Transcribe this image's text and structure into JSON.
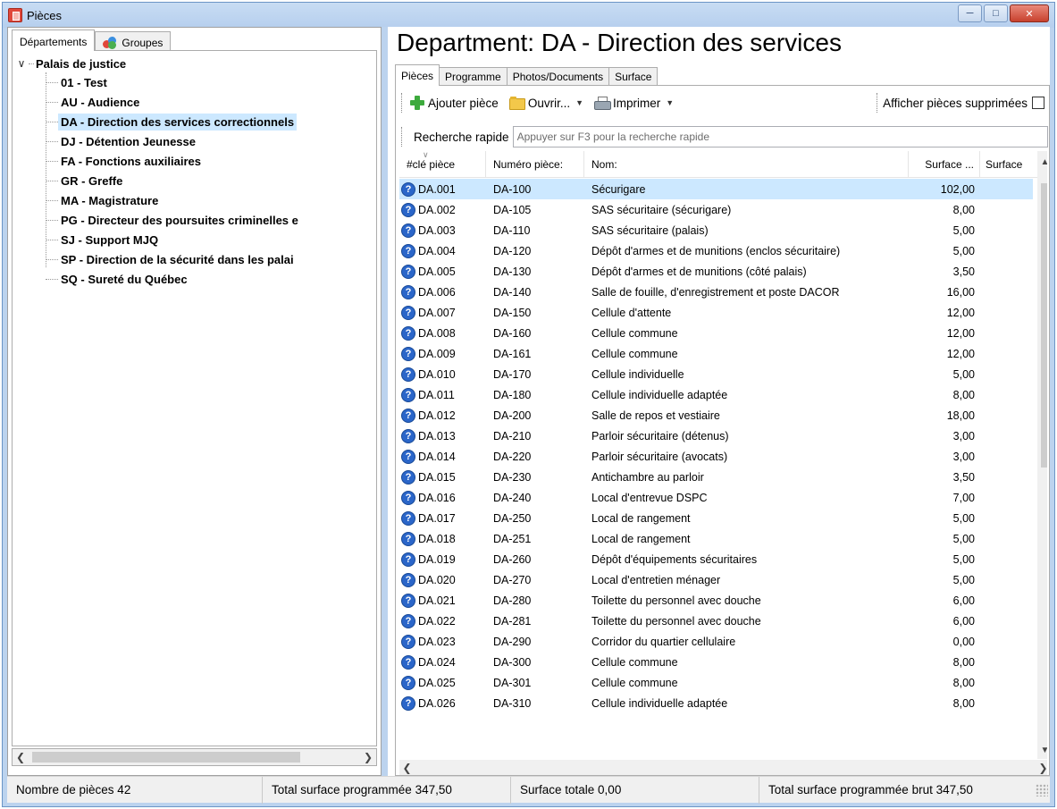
{
  "window": {
    "title": "Pièces"
  },
  "left": {
    "tabs": [
      "Départements",
      "Groupes"
    ],
    "tree": {
      "root": "Palais de justice",
      "items": [
        "01 - Test",
        "AU - Audience",
        "DA - Direction des services correctionnels",
        "DJ - Détention Jeunesse",
        "FA - Fonctions auxiliaires",
        "GR - Greffe",
        "MA - Magistrature",
        "PG - Directeur des poursuites criminelles e",
        "SJ - Support MJQ",
        "SP - Direction de la sécurité dans les palai",
        "SQ - Sureté du Québec"
      ],
      "selected_index": 2
    }
  },
  "main": {
    "title": "Department: DA - Direction des services",
    "tabs": [
      "Pièces",
      "Programme",
      "Photos/Documents",
      "Surface"
    ],
    "toolbar": {
      "add": "Ajouter pièce",
      "open": "Ouvrir...",
      "print": "Imprimer",
      "show_deleted": "Afficher pièces supprimées"
    },
    "search": {
      "label": "Recherche rapide",
      "placeholder": "Appuyer sur F3 pour la recherche rapide",
      "value": ""
    },
    "grid": {
      "columns": [
        "#clé pièce",
        "Numéro pièce:",
        "Nom:",
        "Surface ...",
        "Surface"
      ],
      "rows": [
        {
          "key": "DA.001",
          "num": "DA-100",
          "name": "Sécurigare",
          "surface": "102,00"
        },
        {
          "key": "DA.002",
          "num": "DA-105",
          "name": "SAS sécuritaire (sécurigare)",
          "surface": "8,00"
        },
        {
          "key": "DA.003",
          "num": "DA-110",
          "name": "SAS sécuritaire (palais)",
          "surface": "5,00"
        },
        {
          "key": "DA.004",
          "num": "DA-120",
          "name": "Dépôt d'armes et de munitions (enclos sécuritaire)",
          "surface": "5,00"
        },
        {
          "key": "DA.005",
          "num": "DA-130",
          "name": "Dépôt d'armes et de munitions (côté palais)",
          "surface": "3,50"
        },
        {
          "key": "DA.006",
          "num": "DA-140",
          "name": "Salle de fouille, d'enregistrement et poste DACOR",
          "surface": "16,00"
        },
        {
          "key": "DA.007",
          "num": "DA-150",
          "name": "Cellule d'attente",
          "surface": "12,00"
        },
        {
          "key": "DA.008",
          "num": "DA-160",
          "name": "Cellule commune",
          "surface": "12,00"
        },
        {
          "key": "DA.009",
          "num": "DA-161",
          "name": "Cellule commune",
          "surface": "12,00"
        },
        {
          "key": "DA.010",
          "num": "DA-170",
          "name": "Cellule individuelle",
          "surface": "5,00"
        },
        {
          "key": "DA.011",
          "num": "DA-180",
          "name": "Cellule individuelle adaptée",
          "surface": "8,00"
        },
        {
          "key": "DA.012",
          "num": "DA-200",
          "name": "Salle de repos et vestiaire",
          "surface": "18,00"
        },
        {
          "key": "DA.013",
          "num": "DA-210",
          "name": "Parloir sécuritaire (détenus)",
          "surface": "3,00"
        },
        {
          "key": "DA.014",
          "num": "DA-220",
          "name": "Parloir sécuritaire (avocats)",
          "surface": "3,00"
        },
        {
          "key": "DA.015",
          "num": "DA-230",
          "name": "Antichambre au parloir",
          "surface": "3,50"
        },
        {
          "key": "DA.016",
          "num": "DA-240",
          "name": "Local d'entrevue DSPC",
          "surface": "7,00"
        },
        {
          "key": "DA.017",
          "num": "DA-250",
          "name": "Local de rangement",
          "surface": "5,00"
        },
        {
          "key": "DA.018",
          "num": "DA-251",
          "name": "Local de rangement",
          "surface": "5,00"
        },
        {
          "key": "DA.019",
          "num": "DA-260",
          "name": "Dépôt d'équipements sécuritaires",
          "surface": "5,00"
        },
        {
          "key": "DA.020",
          "num": "DA-270",
          "name": "Local d'entretien ménager",
          "surface": "5,00"
        },
        {
          "key": "DA.021",
          "num": "DA-280",
          "name": "Toilette du personnel avec douche",
          "surface": "6,00"
        },
        {
          "key": "DA.022",
          "num": "DA-281",
          "name": "Toilette du personnel avec douche",
          "surface": "6,00"
        },
        {
          "key": "DA.023",
          "num": "DA-290",
          "name": "Corridor du quartier cellulaire",
          "surface": "0,00"
        },
        {
          "key": "DA.024",
          "num": "DA-300",
          "name": "Cellule commune",
          "surface": "8,00"
        },
        {
          "key": "DA.025",
          "num": "DA-301",
          "name": "Cellule commune",
          "surface": "8,00"
        },
        {
          "key": "DA.026",
          "num": "DA-310",
          "name": "Cellule individuelle adaptée",
          "surface": "8,00"
        }
      ],
      "selected_index": 0
    }
  },
  "status": {
    "count": "Nombre de pièces 42",
    "total_programmed": "Total surface programmée 347,50",
    "total_surface": "Surface totale 0,00",
    "total_gross": "Total surface programmée brut 347,50"
  },
  "colors": {
    "selection": "#cce8ff",
    "frame": "#bcd3ee",
    "help_icon": "#2b66c9",
    "close_button": "#c8412e"
  },
  "icons": [
    "app-icon",
    "groups-icon",
    "add-icon",
    "folder-icon",
    "printer-icon",
    "help-icon"
  ]
}
